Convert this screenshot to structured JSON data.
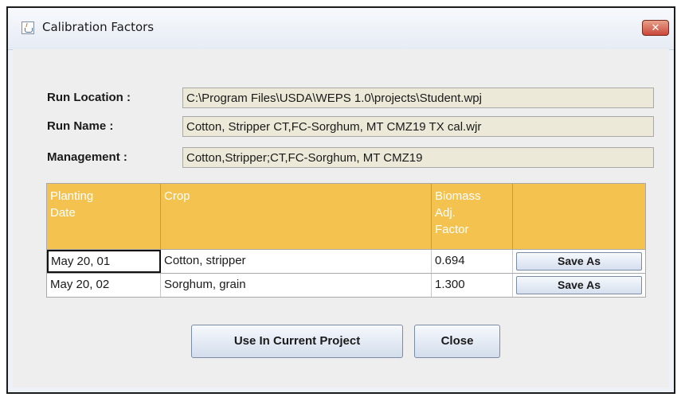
{
  "window": {
    "title": "Calibration Factors",
    "close_glyph": "✕",
    "app_icon": "java-cup-icon"
  },
  "fields": {
    "run_location": {
      "label": "Run Location :",
      "value": "C:\\Program Files\\USDA\\WEPS 1.0\\projects\\Student.wpj"
    },
    "run_name": {
      "label": "Run Name :",
      "value": "Cotton, Stripper CT,FC-Sorghum, MT CMZ19 TX cal.wjr"
    },
    "management": {
      "label": "Management :",
      "value": "Cotton,Stripper;CT,FC-Sorghum, MT CMZ19"
    }
  },
  "table": {
    "headers": {
      "planting_date": [
        "Planting",
        "Date"
      ],
      "crop": [
        "Crop"
      ],
      "biomass": [
        "Biomass",
        "Adj.",
        "Factor"
      ],
      "action": [
        ""
      ]
    },
    "rows": [
      {
        "date": "May 20, 01",
        "crop": "Cotton, stripper",
        "factor": "0.694",
        "action": "Save As"
      },
      {
        "date": "May 20, 02",
        "crop": "Sorghum, grain",
        "factor": "1.300",
        "action": "Save As"
      }
    ]
  },
  "buttons": {
    "use_in_current_project": "Use In Current Project",
    "close": "Close"
  },
  "colors": {
    "header_bg": "#f4c24f",
    "readonly_field_bg": "#ece9d8",
    "close_button": "#c9483a"
  }
}
